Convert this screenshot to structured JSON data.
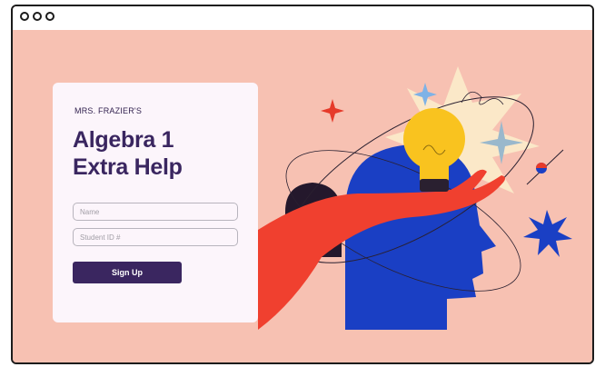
{
  "form": {
    "eyebrow": "MRS. FRAZIER'S",
    "title_line1": "Algebra 1",
    "title_line2": "Extra Help",
    "name_placeholder": "Name",
    "student_id_placeholder": "Student ID #",
    "signup_label": "Sign Up"
  },
  "window": {
    "controls": [
      "window-dot-icon",
      "window-dot-icon",
      "window-dot-icon"
    ]
  },
  "colors": {
    "background": "#f7c1b2",
    "card": "#fcf5fb",
    "primary": "#3a2660",
    "head": "#1a3fc4",
    "hand": "#f0402f",
    "bulb": "#f9c31f"
  }
}
